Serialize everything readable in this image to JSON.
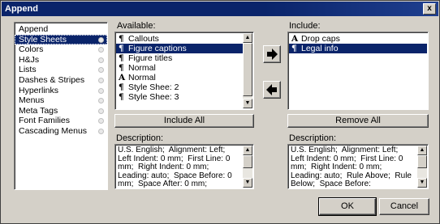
{
  "window": {
    "title": "Append",
    "close_label": "x"
  },
  "nav": {
    "items": [
      {
        "label": "Append",
        "selected": false
      },
      {
        "label": "Style Sheets",
        "selected": true
      },
      {
        "label": "Colors",
        "selected": false
      },
      {
        "label": "H&Js",
        "selected": false
      },
      {
        "label": "Lists",
        "selected": false
      },
      {
        "label": "Dashes & Stripes",
        "selected": false
      },
      {
        "label": "Hyperlinks",
        "selected": false
      },
      {
        "label": "Menus",
        "selected": false
      },
      {
        "label": "Meta Tags",
        "selected": false
      },
      {
        "label": "Font Families",
        "selected": false
      },
      {
        "label": "Cascading Menus",
        "selected": false
      }
    ]
  },
  "available": {
    "label": "Available:",
    "items": [
      {
        "glyph": "¶",
        "label": "Callouts",
        "selected": false
      },
      {
        "glyph": "¶",
        "label": "Figure captions",
        "selected": true
      },
      {
        "glyph": "¶",
        "label": "Figure titles",
        "selected": false
      },
      {
        "glyph": "¶",
        "label": "Normal",
        "selected": false
      },
      {
        "glyph": "A",
        "label": "Normal",
        "selected": false
      },
      {
        "glyph": "¶",
        "label": "Style Shee: 2",
        "selected": false
      },
      {
        "glyph": "¶",
        "label": "Style Shee: 3",
        "selected": false
      }
    ],
    "include_all_label": "Include All",
    "description_label": "Description:",
    "description_text": "U.S. English;  Alignment: Left;  Left Indent: 0 mm;  First Line: 0 mm;  Right Indent: 0 mm;  Leading: auto;  Space Before: 0 mm;  Space After: 0 mm;"
  },
  "include": {
    "label": "Include:",
    "items": [
      {
        "glyph": "A",
        "label": "Drop caps",
        "selected": false
      },
      {
        "glyph": "¶",
        "label": "Legal info",
        "selected": true
      }
    ],
    "remove_all_label": "Remove All",
    "description_label": "Description:",
    "description_text": "U.S. English;  Alignment: Left;  Left Indent: 0 mm;  First Line: 0 mm;  Right Indent: 0 mm;  Leading: auto;  Rule Above;  Rule Below;  Space Before:"
  },
  "footer": {
    "ok_label": "OK",
    "cancel_label": "Cancel"
  }
}
